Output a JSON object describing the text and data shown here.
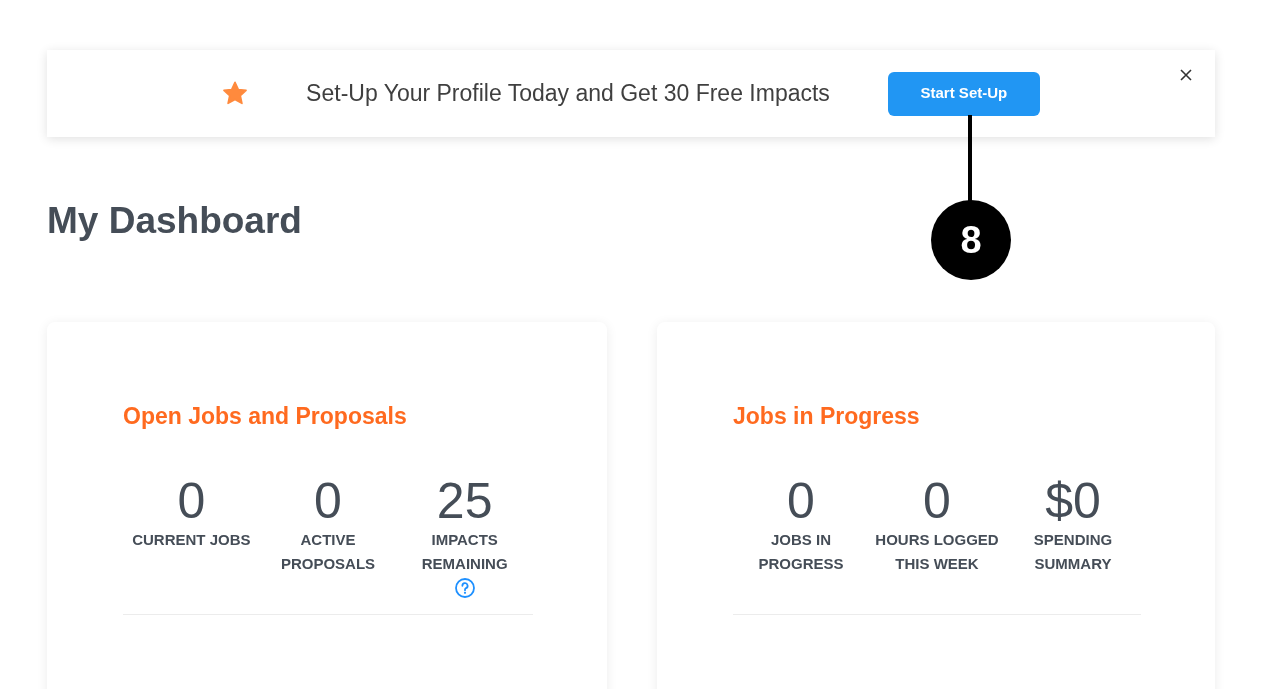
{
  "banner": {
    "message": "Set-Up Your Profile Today and Get 30 Free Impacts",
    "button": "Start Set-Up"
  },
  "annotation": {
    "label": "8"
  },
  "page_title": "My Dashboard",
  "cards": [
    {
      "title": "Open Jobs and Proposals",
      "stats": [
        {
          "value": "0",
          "label": "CURRENT JOBS",
          "help": false
        },
        {
          "value": "0",
          "label": "ACTIVE PROPOSALS",
          "help": false
        },
        {
          "value": "25",
          "label": "IMPACTS REMAINING",
          "help": true
        }
      ]
    },
    {
      "title": "Jobs in Progress",
      "stats": [
        {
          "value": "0",
          "label": "JOBS IN PROGRESS",
          "help": false
        },
        {
          "value": "0",
          "label": "HOURS LOGGED THIS WEEK",
          "help": false
        },
        {
          "value": "$0",
          "label": "SPENDING SUMMARY",
          "help": false
        }
      ]
    }
  ]
}
